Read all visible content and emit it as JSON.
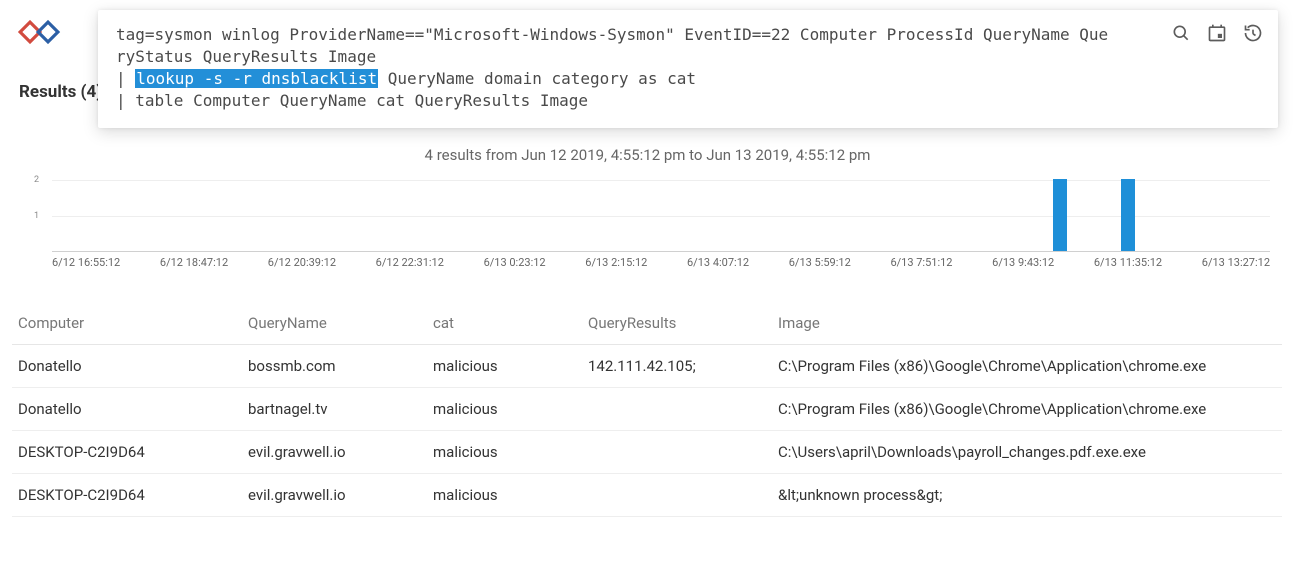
{
  "results_label": "Results (4)",
  "query": {
    "line1a": "tag=sysmon winlog ProviderName==\"Microsoft-Windows-Sysmon\" EventID==22 Computer ProcessId QueryName Que",
    "line1b": "ryStatus QueryResults Image",
    "line2_pipe": "| ",
    "line2_hl": "lookup -s -r dnsblacklist",
    "line2_rest": " QueryName domain category as cat",
    "line3": "| table Computer QueryName cat QueryResults Image"
  },
  "summary": "4 results from Jun 12 2019, 4:55:12 pm to Jun 13 2019, 4:55:12 pm",
  "chart_data": {
    "type": "bar",
    "ylim": [
      0,
      2
    ],
    "yticks": [
      1,
      2
    ],
    "x_tick_count": 12,
    "categories": [
      "6/12 16:55:12",
      "6/12 18:47:12",
      "6/12 20:39:12",
      "6/12 22:31:12",
      "6/13 0:23:12",
      "6/13 2:15:12",
      "6/13 4:07:12",
      "6/13 5:59:12",
      "6/13 7:51:12",
      "6/13 9:43:12",
      "6/13 11:35:12",
      "6/13 13:27:12"
    ],
    "bars": [
      {
        "pos_frac": 0.822,
        "value": 2
      },
      {
        "pos_frac": 0.878,
        "value": 2
      }
    ],
    "color": "#1e8fd8"
  },
  "table": {
    "columns": [
      "Computer",
      "QueryName",
      "cat",
      "QueryResults",
      "Image"
    ],
    "rows": [
      {
        "Computer": "Donatello",
        "QueryName": "bossmb.com",
        "cat": "malicious",
        "QueryResults": "142.111.42.105;",
        "Image": "C:\\Program Files (x86)\\Google\\Chrome\\Application\\chrome.exe"
      },
      {
        "Computer": "Donatello",
        "QueryName": "bartnagel.tv",
        "cat": "malicious",
        "QueryResults": "",
        "Image": "C:\\Program Files (x86)\\Google\\Chrome\\Application\\chrome.exe"
      },
      {
        "Computer": "DESKTOP-C2I9D64",
        "QueryName": "evil.gravwell.io",
        "cat": "malicious",
        "QueryResults": "",
        "Image": "C:\\Users\\april\\Downloads\\payroll_changes.pdf.exe.exe"
      },
      {
        "Computer": "DESKTOP-C2I9D64",
        "QueryName": "evil.gravwell.io",
        "cat": "malicious",
        "QueryResults": "",
        "Image": "&lt;unknown process&gt;"
      }
    ]
  }
}
